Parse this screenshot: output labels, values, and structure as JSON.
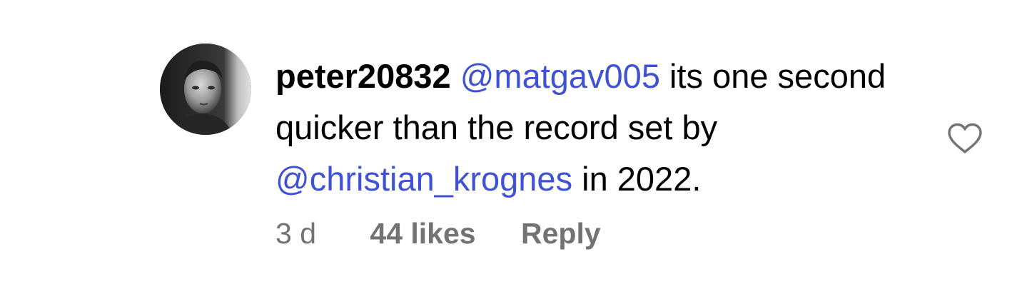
{
  "comment": {
    "username": "peter20832",
    "mention_1": "@matgav005",
    "text_1": " its one second quicker than the record set by ",
    "mention_2": "@christian_krognes",
    "text_2": " in 2022.",
    "time": "3 d",
    "likes": "44 likes",
    "reply_label": "Reply"
  },
  "colors": {
    "mention": "#3f51d4",
    "meta": "#737373",
    "text": "#000000"
  },
  "icons": {
    "avatar": "avatar",
    "like": "heart-outline-icon"
  }
}
